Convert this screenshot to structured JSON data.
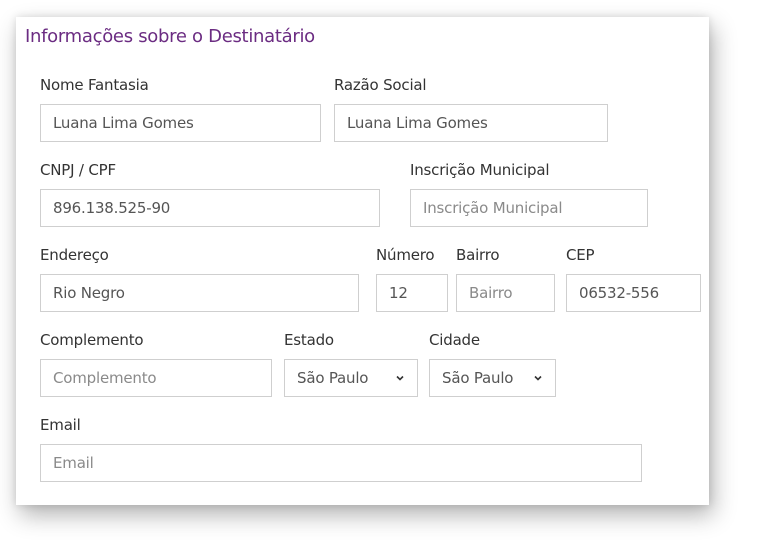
{
  "form": {
    "title": "Informações sobre o Destinatário",
    "fields": {
      "nome_fantasia": {
        "label": "Nome Fantasia",
        "value": "Luana Lima Gomes",
        "placeholder": ""
      },
      "razao_social": {
        "label": "Razão Social",
        "value": "Luana Lima Gomes",
        "placeholder": ""
      },
      "cnpj_cpf": {
        "label": "CNPJ / CPF",
        "value": "896.138.525-90",
        "placeholder": ""
      },
      "inscricao_municipal": {
        "label": "Inscrição Municipal",
        "value": "",
        "placeholder": "Inscrição Municipal"
      },
      "endereco": {
        "label": "Endereço",
        "value": "Rio Negro",
        "placeholder": ""
      },
      "numero": {
        "label": "Número",
        "value": "12",
        "placeholder": ""
      },
      "bairro": {
        "label": "Bairro",
        "value": "",
        "placeholder": "Bairro"
      },
      "cep": {
        "label": "CEP",
        "value": "06532-556",
        "placeholder": ""
      },
      "complemento": {
        "label": "Complemento",
        "value": "",
        "placeholder": "Complemento"
      },
      "estado": {
        "label": "Estado",
        "selected": "São Paulo"
      },
      "cidade": {
        "label": "Cidade",
        "selected": "São Paulo"
      },
      "email": {
        "label": "Email",
        "value": "",
        "placeholder": "Email"
      }
    }
  },
  "colors": {
    "title": "#6b2c82",
    "border": "#cfcfcf",
    "text": "#333333",
    "placeholder": "#8a8a8a"
  }
}
